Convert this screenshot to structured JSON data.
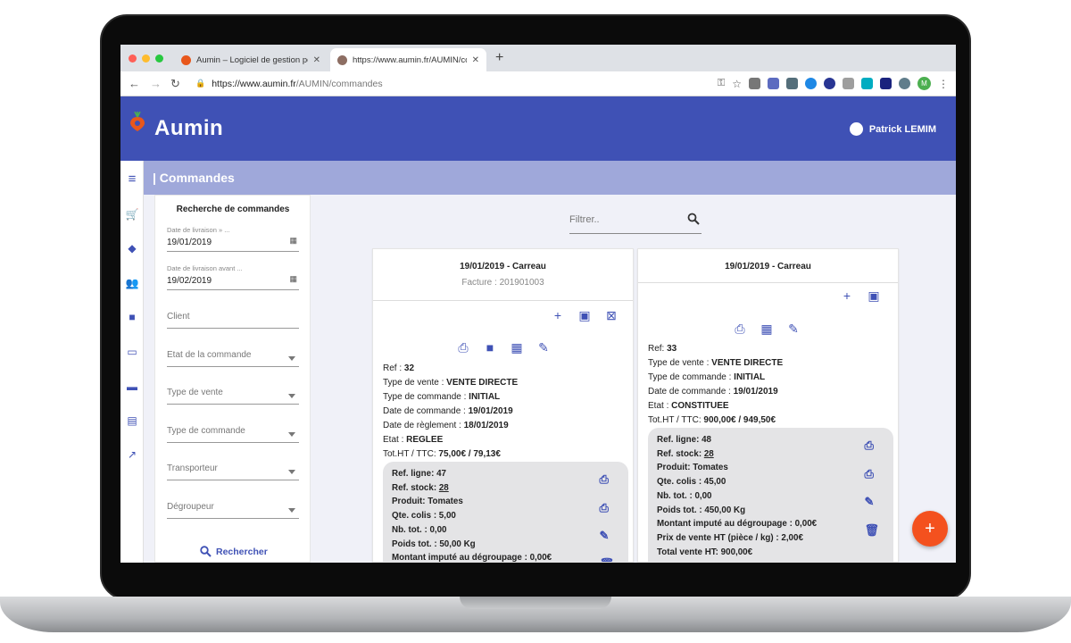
{
  "browser": {
    "tabs": [
      {
        "title": "Aumin – Logiciel de gestion pou",
        "close": "✕"
      },
      {
        "title": "https://www.aumin.fr/AUMIN/co",
        "close": "✕"
      }
    ],
    "new_tab": "+",
    "url_prefix": "https://www.aumin.fr",
    "url_path": "/AUMIN/commandes",
    "profile_initial": "M",
    "colors": {
      "tabbar": "#dee1e6",
      "close_dot": "#ff5f57",
      "min_dot": "#febc2e",
      "max_dot": "#28c840"
    }
  },
  "app": {
    "title": "Aumin",
    "user_name": "Patrick LEMIM",
    "page_title": "| Commandes",
    "colors": {
      "primary": "#3f51b5",
      "subheader": "#9fa8da",
      "accent": "#f4511e",
      "logo": "#e8571b"
    }
  },
  "rail": {
    "icons": [
      "menu-icon",
      "cart-icon",
      "tag-icon",
      "people-icon",
      "book-icon",
      "credit-card-icon",
      "ticket-icon",
      "clipboard-icon",
      "trending-up-icon"
    ]
  },
  "search": {
    "title": "Recherche de commandes",
    "date_after_label": "Date de livraison » ...",
    "date_after_value": "19/01/2019",
    "date_before_label": "Date de livraison avant ...",
    "date_before_value": "19/02/2019",
    "client_placeholder": "Client",
    "selects": [
      "Etat de la commande",
      "Type de vente",
      "Type de commande",
      "Transporteur",
      "Dégroupeur"
    ],
    "button": "Rechercher"
  },
  "filter": {
    "placeholder": "Filtrer.."
  },
  "orders": [
    {
      "title": "19/01/2019 - Carreau",
      "subtitle": "Facture : 201901003",
      "fields": [
        {
          "label": "Ref : ",
          "value": "32"
        },
        {
          "label": "Type de vente : ",
          "value": "VENTE DIRECTE"
        },
        {
          "label": "Type de commande : ",
          "value": "INITIAL"
        },
        {
          "label": "Date de commande : ",
          "value": "19/01/2019"
        },
        {
          "label": "Date de règlement : ",
          "value": "18/01/2019"
        },
        {
          "label": "Etat : ",
          "value": "REGLEE"
        },
        {
          "label": "Tot.HT / TTC: ",
          "value": "75,00€ / 79,13€"
        }
      ],
      "line": {
        "ref_ligne": "Ref. ligne: 47",
        "ref_stock_label": "Ref. stock: ",
        "ref_stock_value": "28",
        "produit": "Produit: Tomates",
        "qte_colis": "Qte. colis : 5,00",
        "nb_tot": "Nb. tot. : 0,00",
        "poids_tot": "Poids tot. : 50,00 Kg",
        "montant": "Montant imputé au dégroupage : 0,00€"
      }
    },
    {
      "title": "19/01/2019 - Carreau",
      "fields": [
        {
          "label": "Ref: ",
          "value": "33"
        },
        {
          "label": "Type de vente : ",
          "value": "VENTE DIRECTE"
        },
        {
          "label": "Type de commande : ",
          "value": "INITIAL"
        },
        {
          "label": "Date de commande : ",
          "value": "19/01/2019"
        },
        {
          "label": "Etat : ",
          "value": "CONSTITUEE"
        },
        {
          "label": "Tot.HT / TTC: ",
          "value": "900,00€ / 949,50€"
        }
      ],
      "line": {
        "ref_ligne": "Ref. ligne: 48",
        "ref_stock_label": "Ref. stock: ",
        "ref_stock_value": "28",
        "produit": "Produit: Tomates",
        "qte_colis": "Qte. colis : 45,00",
        "nb_tot": "Nb. tot. : 0,00",
        "poids_tot": "Poids tot. : 450,00 Kg",
        "montant": "Montant imputé au dégroupage : 0,00€",
        "prix": "Prix de vente HT (pièce / kg) : 2,00€",
        "total": "Total vente HT: 900,00€"
      }
    }
  ],
  "fab": "+"
}
